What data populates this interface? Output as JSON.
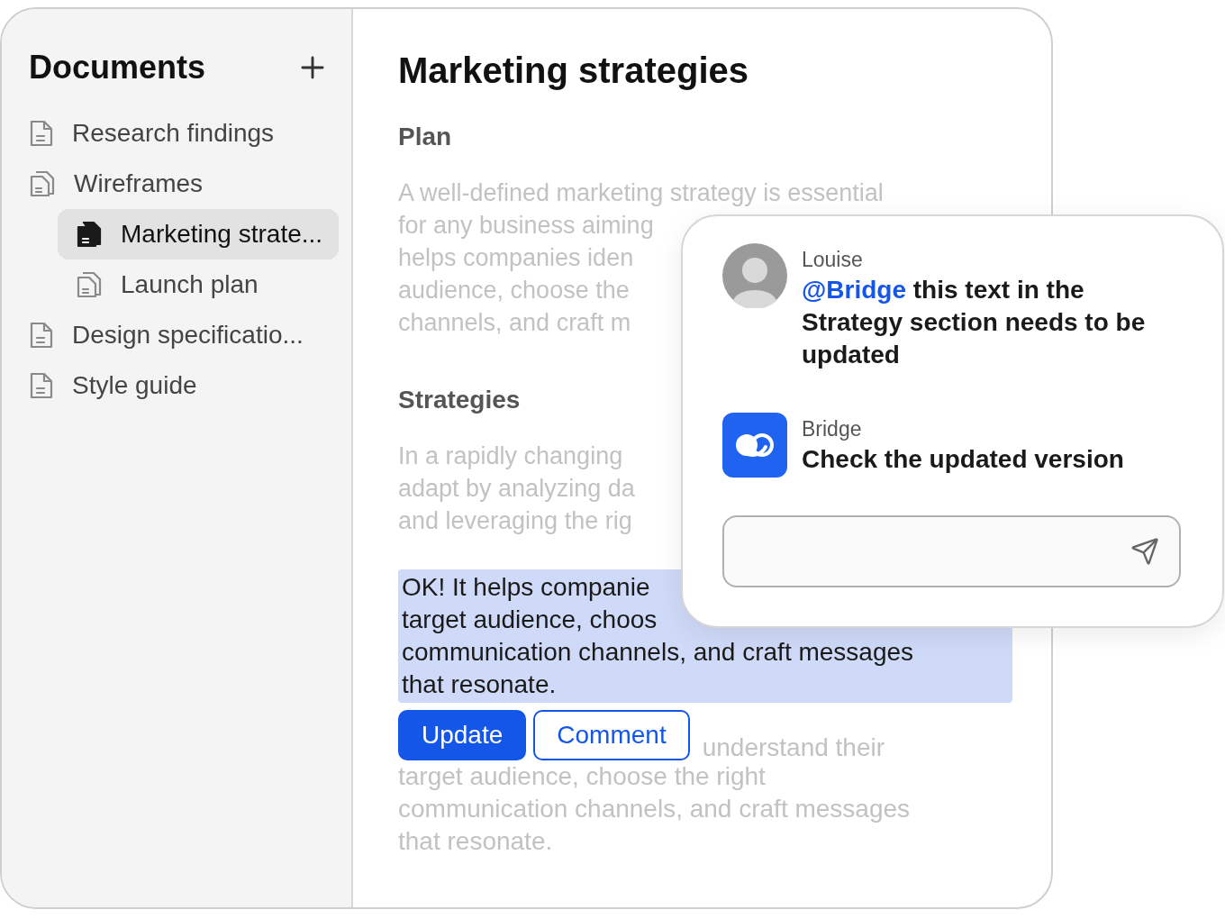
{
  "sidebar": {
    "title": "Documents",
    "items": [
      {
        "label": "Research findings",
        "kind": "file",
        "selected": false
      },
      {
        "label": "Wireframes",
        "kind": "files",
        "selected": false,
        "children": [
          {
            "label": "Marketing strate...",
            "kind": "files",
            "selected": true
          },
          {
            "label": "Launch plan",
            "kind": "files",
            "selected": false
          }
        ]
      },
      {
        "label": "Design specificatio...",
        "kind": "file",
        "selected": false
      },
      {
        "label": "Style guide",
        "kind": "file",
        "selected": false
      }
    ]
  },
  "document": {
    "title": "Marketing strategies",
    "sections": [
      {
        "heading": "Plan",
        "lines": [
          "A well-defined marketing strategy is essential",
          "for any business aiming",
          "helps companies iden",
          "audience, choose the",
          "channels, and craft m"
        ]
      },
      {
        "heading": "Strategies",
        "lines": [
          "In a rapidly changing",
          "adapt by analyzing da",
          "and leveraging the rig"
        ]
      }
    ],
    "highlight": {
      "lines": [
        "OK! It helps companie",
        "target audience, choos",
        "communication channels, and craft messages",
        "that resonate."
      ]
    },
    "actions": [
      {
        "label": "Update",
        "kind": "primary"
      },
      {
        "label": "Comment",
        "kind": "secondary"
      }
    ],
    "trailing_lines": [
      "understand their",
      "target audience, choose the right",
      "communication channels, and craft messages",
      "that resonate."
    ]
  },
  "comments": {
    "messages": [
      {
        "author": "Louise",
        "kind": "photo",
        "mention": "@Bridge",
        "text": "this text in the Strategy section needs to be updated"
      },
      {
        "author": "Bridge",
        "kind": "logo",
        "text": "Check the updated version"
      }
    ]
  }
}
